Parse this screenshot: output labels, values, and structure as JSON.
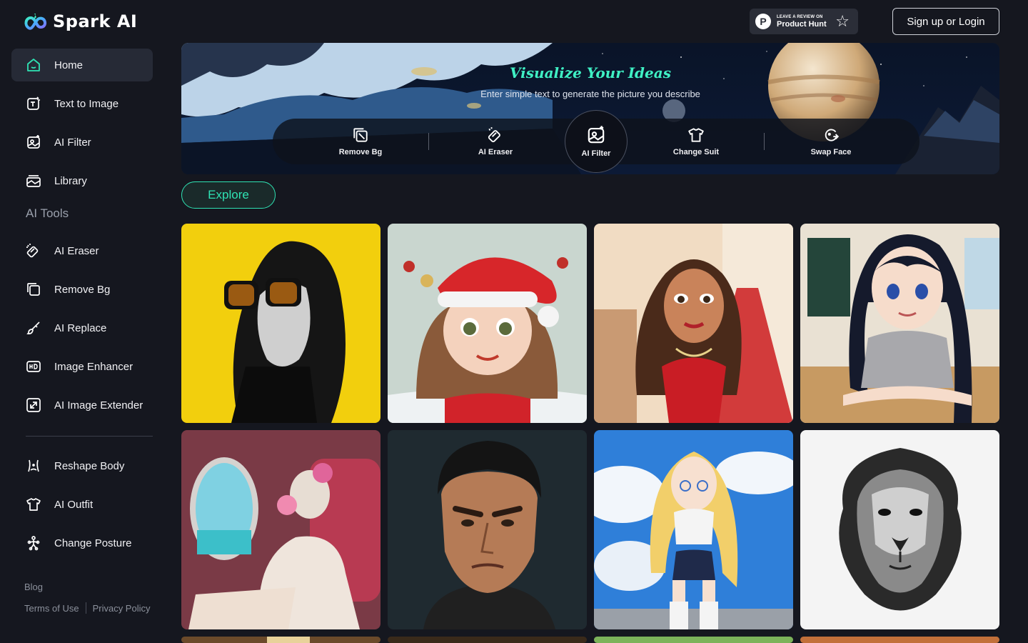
{
  "app": {
    "name": "Spark AI"
  },
  "sidebar": {
    "items": [
      {
        "label": "Home",
        "icon": "home-icon"
      },
      {
        "label": "Text to Image",
        "icon": "text-to-image-icon"
      },
      {
        "label": "AI Filter",
        "icon": "ai-filter-icon"
      },
      {
        "label": "Library",
        "icon": "library-icon"
      }
    ],
    "section_title": "AI Tools",
    "tools": [
      {
        "label": "AI Eraser",
        "icon": "eraser-icon"
      },
      {
        "label": "Remove Bg",
        "icon": "remove-bg-icon"
      },
      {
        "label": "AI Replace",
        "icon": "brush-icon"
      },
      {
        "label": "Image Enhancer",
        "icon": "hd-icon"
      },
      {
        "label": "AI Image Extender",
        "icon": "expand-icon"
      }
    ],
    "extras": [
      {
        "label": "Reshape Body",
        "icon": "body-icon"
      },
      {
        "label": "AI Outfit",
        "icon": "shirt-icon"
      },
      {
        "label": "Change Posture",
        "icon": "posture-icon"
      }
    ],
    "footer": {
      "blog": "Blog",
      "terms": "Terms of Use",
      "privacy": "Privacy Policy"
    }
  },
  "header": {
    "product_hunt_small": "LEAVE A REVIEW ON",
    "product_hunt_big": "Product Hunt",
    "product_hunt_logo": "P",
    "login_label": "Sign up or Login"
  },
  "banner": {
    "title": "Visualize Your Ideas",
    "subtitle": "Enter simple text to generate the picture you describe",
    "tools": [
      {
        "label": "Remove Bg",
        "icon": "remove-bg-icon"
      },
      {
        "label": "AI Eraser",
        "icon": "eraser-icon"
      },
      {
        "label": "AI Filter",
        "icon": "ai-filter-icon",
        "active": true
      },
      {
        "label": "Change Suit",
        "icon": "shirt-icon"
      },
      {
        "label": "Swap Face",
        "icon": "swap-face-icon"
      }
    ]
  },
  "explore": {
    "label": "Explore"
  },
  "colors": {
    "accent": "#2fe3b4",
    "background": "#15171f",
    "active_nav": "#262a36"
  }
}
